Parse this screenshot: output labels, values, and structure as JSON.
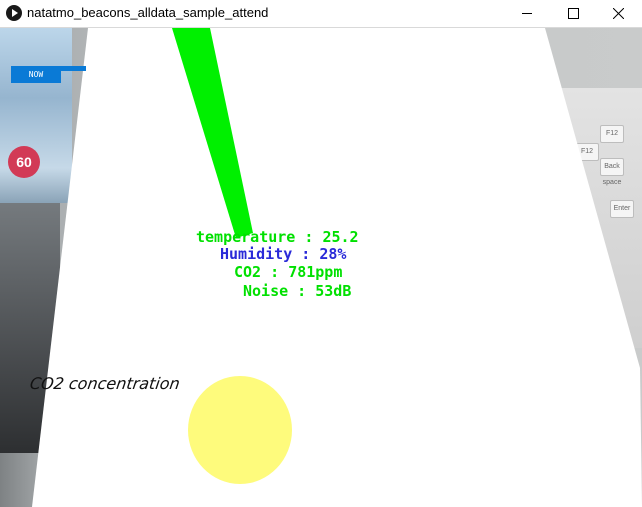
{
  "window": {
    "title": "natatmo_beacons_alldata_sample_attend"
  },
  "now_button": {
    "label": "NOW",
    "color": "#0a7ad6"
  },
  "readings": {
    "temperature": {
      "label": "temperature",
      "value": "25.2",
      "color": "#00e000"
    },
    "humidity": {
      "label": "Humidity",
      "value": "28%",
      "color": "#2a2ad8"
    },
    "co2": {
      "label": "CO2",
      "value": "781ppm",
      "color": "#00e000"
    },
    "noise": {
      "label": "Noise",
      "value": "53dB",
      "color": "#00e000"
    }
  },
  "co2_section": {
    "label": "CO2 concentration",
    "circle_color": "#fefb7c"
  },
  "background": {
    "bag_badge": "60",
    "keyboard_keys": [
      "F12",
      "F12",
      "Back space",
      "Enter"
    ]
  },
  "colors": {
    "indicator_bar": "#00f000"
  }
}
